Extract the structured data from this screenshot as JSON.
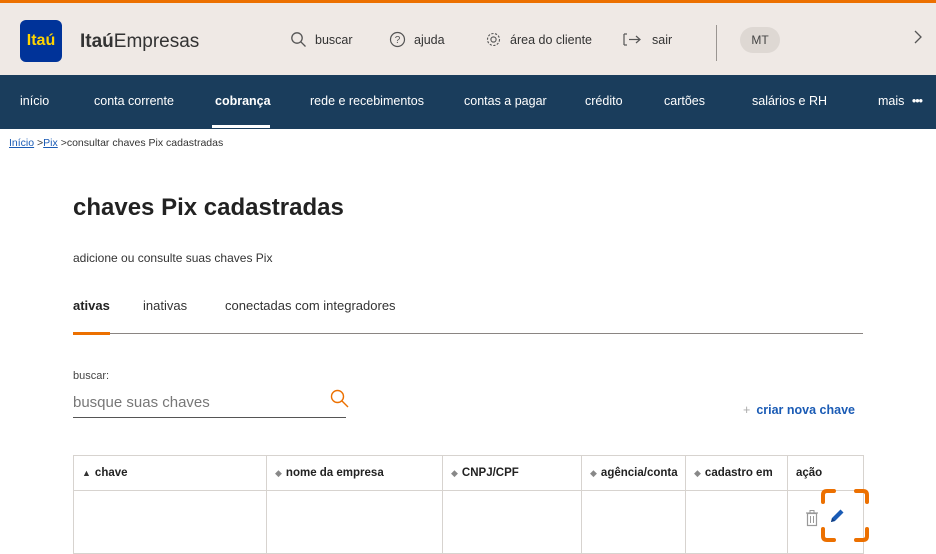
{
  "header": {
    "logo_text": "Itaú",
    "brand_bold": "Itaú",
    "brand_light": "Empresas",
    "tools": [
      {
        "icon": "search-icon",
        "label": "buscar"
      },
      {
        "icon": "help-icon",
        "label": "ajuda"
      },
      {
        "icon": "gear-icon",
        "label": "área do cliente"
      },
      {
        "icon": "logout-icon",
        "label": "sair"
      }
    ],
    "avatar_initials": "MT"
  },
  "nav": {
    "items": [
      {
        "label": "início"
      },
      {
        "label": "conta corrente"
      },
      {
        "label": "cobrança"
      },
      {
        "label": "rede e recebimentos"
      },
      {
        "label": "contas a pagar"
      },
      {
        "label": "crédito"
      },
      {
        "label": "cartões"
      },
      {
        "label": "salários e RH"
      },
      {
        "label": "mais"
      }
    ],
    "active": "cobrança"
  },
  "breadcrumb": {
    "items": [
      "Início",
      "Pix"
    ],
    "current": "consultar chaves Pix cadastradas",
    "separator": ">"
  },
  "page": {
    "title": "chaves Pix cadastradas",
    "subtitle": "adicione ou consulte suas chaves Pix"
  },
  "tabs": [
    {
      "label": "ativas",
      "active": true
    },
    {
      "label": "inativas",
      "active": false
    },
    {
      "label": "conectadas com integradores",
      "active": false
    }
  ],
  "search": {
    "label": "buscar:",
    "placeholder": "busque suas chaves"
  },
  "create_button": {
    "plus": "+",
    "label": "criar nova chave"
  },
  "table": {
    "columns": [
      "chave",
      "nome da empresa",
      "CNPJ/CPF",
      "agência/conta",
      "cadastro em",
      "ação"
    ],
    "rows": [
      {
        "chave": "",
        "nome": "",
        "documento": "",
        "agencia": "",
        "cadastro": ""
      }
    ]
  },
  "colors": {
    "accent": "#ec7000",
    "nav_bg": "#1a3d5c",
    "header_bg": "#efe9e5",
    "link": "#1a5bb5",
    "logo_bg": "#003399",
    "logo_text": "#ffd400"
  }
}
